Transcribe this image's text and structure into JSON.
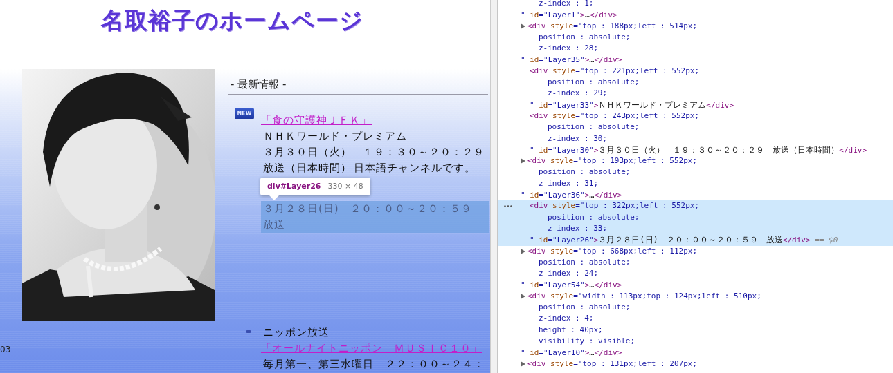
{
  "page": {
    "title": "名取裕子のホームページ",
    "side_text": "03",
    "news": {
      "heading": "- 最新情報 -",
      "items": [
        {
          "kind": "new",
          "badge": "NEW",
          "lines": [
            {
              "kind": "link",
              "texts": [
                "「食の守護神ＪＦＫ」"
              ]
            },
            {
              "kind": "text",
              "texts": [
                "ＮＨＫワールド・プレミアム"
              ]
            },
            {
              "kind": "text",
              "texts": [
                "３月３０日（火）　１９：３０～２０：２９"
              ]
            },
            {
              "kind": "text",
              "texts": [
                "放送（日本時間）",
                "日本語チャンネルです。"
              ]
            },
            {
              "kind": "highlighted",
              "texts": [
                "３月２８日(日)　２０：００～２０：５９"
              ]
            },
            {
              "kind": "highlighted",
              "texts": [
                "放送"
              ]
            }
          ]
        },
        {
          "kind": "bullet",
          "lines": [
            {
              "kind": "text",
              "texts": [
                "ニッポン放送"
              ]
            },
            {
              "kind": "link",
              "texts": [
                "「オールナイトニッポン　ＭＵＳＩＣ１０」"
              ]
            },
            {
              "kind": "text",
              "texts": [
                "毎月第一、第三水曜日　２２：００～２４："
              ]
            }
          ]
        }
      ]
    },
    "tooltip": {
      "selector": "div#Layer26",
      "size": "330 × 48"
    }
  },
  "elements_panel": {
    "nodes": [
      {
        "selected": false,
        "lines": [
          {
            "kind": "prop",
            "parts": [
              {
                "kind": "val",
                "text": "z-index : 1;"
              }
            ]
          },
          {
            "kind": "close",
            "parts": [
              {
                "kind": "val",
                "text": "\" "
              },
              {
                "kind": "attr",
                "text": "id"
              },
              {
                "kind": "val",
                "text": "=\"Layer1\""
              },
              {
                "kind": "tag",
                "text": ">"
              },
              {
                "kind": "text",
                "text": "…"
              },
              {
                "kind": "tag",
                "text": "</div>"
              }
            ]
          }
        ]
      },
      {
        "expandable": true,
        "selected": false,
        "lines": [
          {
            "kind": "open",
            "parts": [
              {
                "kind": "tag",
                "text": "<div"
              },
              {
                "kind": "attr",
                "text": " style"
              },
              {
                "kind": "val",
                "text": "=\"top : 188px;left : 514px;"
              }
            ]
          },
          {
            "kind": "prop",
            "parts": [
              {
                "kind": "val",
                "text": "position : absolute;"
              }
            ]
          },
          {
            "kind": "prop",
            "parts": [
              {
                "kind": "val",
                "text": "z-index : 28;"
              }
            ]
          },
          {
            "kind": "close",
            "parts": [
              {
                "kind": "val",
                "text": "\" "
              },
              {
                "kind": "attr",
                "text": "id"
              },
              {
                "kind": "val",
                "text": "=\"Layer35\""
              },
              {
                "kind": "tag",
                "text": ">"
              },
              {
                "kind": "text",
                "text": "…"
              },
              {
                "kind": "tag",
                "text": "</div>"
              }
            ]
          }
        ]
      },
      {
        "expandable": false,
        "selected": false,
        "lines": [
          {
            "kind": "open",
            "parts": [
              {
                "kind": "tag",
                "text": "<div"
              },
              {
                "kind": "attr",
                "text": " style"
              },
              {
                "kind": "val",
                "text": "=\"top : 221px;left : 552px;"
              }
            ]
          },
          {
            "kind": "prop",
            "parts": [
              {
                "kind": "val",
                "text": "position : absolute;"
              }
            ]
          },
          {
            "kind": "prop",
            "parts": [
              {
                "kind": "val",
                "text": "z-index : 29;"
              }
            ]
          },
          {
            "kind": "close",
            "parts": [
              {
                "kind": "val",
                "text": "\" "
              },
              {
                "kind": "attr",
                "text": "id"
              },
              {
                "kind": "val",
                "text": "=\"Layer33\""
              },
              {
                "kind": "tag",
                "text": ">"
              },
              {
                "kind": "text",
                "text": "ＮＨＫワールド・プレミアム"
              },
              {
                "kind": "tag",
                "text": "</div>"
              }
            ]
          }
        ]
      },
      {
        "expandable": false,
        "selected": false,
        "lines": [
          {
            "kind": "open",
            "parts": [
              {
                "kind": "tag",
                "text": "<div"
              },
              {
                "kind": "attr",
                "text": " style"
              },
              {
                "kind": "val",
                "text": "=\"top : 243px;left : 552px;"
              }
            ]
          },
          {
            "kind": "prop",
            "parts": [
              {
                "kind": "val",
                "text": "position : absolute;"
              }
            ]
          },
          {
            "kind": "prop",
            "parts": [
              {
                "kind": "val",
                "text": "z-index : 30;"
              }
            ]
          },
          {
            "kind": "close",
            "parts": [
              {
                "kind": "val",
                "text": "\" "
              },
              {
                "kind": "attr",
                "text": "id"
              },
              {
                "kind": "val",
                "text": "=\"Layer30\""
              },
              {
                "kind": "tag",
                "text": ">"
              },
              {
                "kind": "text",
                "text": "３月３０日（火）　１９：３０～２０：２９　放送（日本時間）"
              },
              {
                "kind": "tag",
                "text": "</div>"
              }
            ]
          }
        ]
      },
      {
        "expandable": true,
        "selected": false,
        "lines": [
          {
            "kind": "open",
            "parts": [
              {
                "kind": "tag",
                "text": "<div"
              },
              {
                "kind": "attr",
                "text": " style"
              },
              {
                "kind": "val",
                "text": "=\"top : 193px;left : 552px;"
              }
            ]
          },
          {
            "kind": "prop",
            "parts": [
              {
                "kind": "val",
                "text": "position : absolute;"
              }
            ]
          },
          {
            "kind": "prop",
            "parts": [
              {
                "kind": "val",
                "text": "z-index : 31;"
              }
            ]
          },
          {
            "kind": "close",
            "parts": [
              {
                "kind": "val",
                "text": "\" "
              },
              {
                "kind": "attr",
                "text": "id"
              },
              {
                "kind": "val",
                "text": "=\"Layer36\""
              },
              {
                "kind": "tag",
                "text": ">"
              },
              {
                "kind": "text",
                "text": "…"
              },
              {
                "kind": "tag",
                "text": "</div>"
              }
            ]
          }
        ]
      },
      {
        "expandable": false,
        "selected": true,
        "lines": [
          {
            "kind": "open",
            "parts": [
              {
                "kind": "tag",
                "text": "<div"
              },
              {
                "kind": "attr",
                "text": " style"
              },
              {
                "kind": "val",
                "text": "=\"top : 322px;left : 552px;"
              }
            ]
          },
          {
            "kind": "prop",
            "parts": [
              {
                "kind": "val",
                "text": "position : absolute;"
              }
            ]
          },
          {
            "kind": "prop",
            "parts": [
              {
                "kind": "val",
                "text": "z-index : 33;"
              }
            ]
          },
          {
            "kind": "close",
            "parts": [
              {
                "kind": "val",
                "text": "\" "
              },
              {
                "kind": "attr",
                "text": "id"
              },
              {
                "kind": "val",
                "text": "=\"Layer26\""
              },
              {
                "kind": "tag",
                "text": ">"
              },
              {
                "kind": "text",
                "text": "３月２８日(日)　２０：００～２０：５９　放送"
              },
              {
                "kind": "tag",
                "text": "</div>"
              },
              {
                "kind": "dim",
                "text": " == $0"
              }
            ]
          }
        ]
      },
      {
        "expandable": true,
        "selected": false,
        "lines": [
          {
            "kind": "open",
            "parts": [
              {
                "kind": "tag",
                "text": "<div"
              },
              {
                "kind": "attr",
                "text": " style"
              },
              {
                "kind": "val",
                "text": "=\"top : 668px;left : 112px;"
              }
            ]
          },
          {
            "kind": "prop",
            "parts": [
              {
                "kind": "val",
                "text": "position : absolute;"
              }
            ]
          },
          {
            "kind": "prop",
            "parts": [
              {
                "kind": "val",
                "text": "z-index : 24;"
              }
            ]
          },
          {
            "kind": "close",
            "parts": [
              {
                "kind": "val",
                "text": "\" "
              },
              {
                "kind": "attr",
                "text": "id"
              },
              {
                "kind": "val",
                "text": "=\"Layer54\""
              },
              {
                "kind": "tag",
                "text": ">"
              },
              {
                "kind": "text",
                "text": "…"
              },
              {
                "kind": "tag",
                "text": "</div>"
              }
            ]
          }
        ]
      },
      {
        "expandable": true,
        "selected": false,
        "lines": [
          {
            "kind": "open",
            "parts": [
              {
                "kind": "tag",
                "text": "<div"
              },
              {
                "kind": "attr",
                "text": " style"
              },
              {
                "kind": "val",
                "text": "=\"width : 113px;top : 124px;left : 510px;"
              }
            ]
          },
          {
            "kind": "prop",
            "parts": [
              {
                "kind": "val",
                "text": "position : absolute;"
              }
            ]
          },
          {
            "kind": "prop",
            "parts": [
              {
                "kind": "val",
                "text": "z-index : 4;"
              }
            ]
          },
          {
            "kind": "prop",
            "parts": [
              {
                "kind": "val",
                "text": "height : 40px;"
              }
            ]
          },
          {
            "kind": "prop",
            "parts": [
              {
                "kind": "val",
                "text": "visibility : visible;"
              }
            ]
          },
          {
            "kind": "close",
            "parts": [
              {
                "kind": "val",
                "text": "\" "
              },
              {
                "kind": "attr",
                "text": "id"
              },
              {
                "kind": "val",
                "text": "=\"Layer10\""
              },
              {
                "kind": "tag",
                "text": ">"
              },
              {
                "kind": "text",
                "text": "…"
              },
              {
                "kind": "tag",
                "text": "</div>"
              }
            ]
          }
        ]
      },
      {
        "expandable": true,
        "selected": false,
        "lines": [
          {
            "kind": "open",
            "parts": [
              {
                "kind": "tag",
                "text": "<div"
              },
              {
                "kind": "attr",
                "text": " style"
              },
              {
                "kind": "val",
                "text": "=\"top : 131px;left : 207px;"
              }
            ]
          }
        ]
      }
    ]
  }
}
